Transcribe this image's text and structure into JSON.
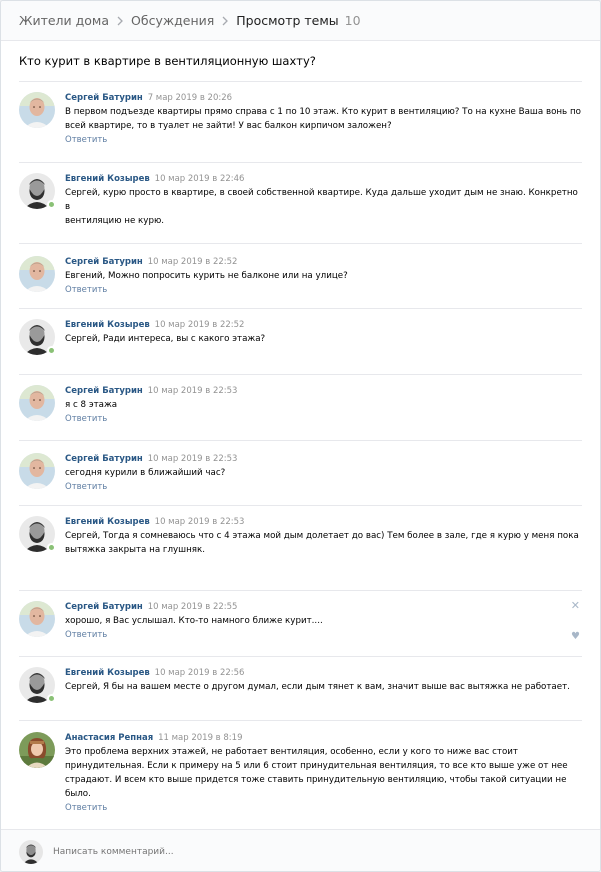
{
  "breadcrumbs": {
    "items": [
      "Жители дома",
      "Обсуждения"
    ],
    "current": "Просмотр темы",
    "count": "10"
  },
  "topic": {
    "title": "Кто курит в квартире в вентиляционную шахту?"
  },
  "comments": [
    {
      "author": "Сергей Батурин",
      "date": "7 мар 2019 в 20:26",
      "lines": [
        "В первом подъезде квартиры прямо справа с 1 по 10 этаж. Кто курит в вентиляцию? То на кухне Ваша вонь по",
        "всей квартире, то в туалет не зайти! У вас балкон кирпичом заложен?"
      ],
      "reply": "Ответить",
      "avatar": "sergey"
    },
    {
      "author": "Евгений Козырев",
      "date": "10 мар 2019 в 22:46",
      "lines": [
        "Сергей, курю просто в квартире, в своей собственной квартире. Куда дальше уходит дым не знаю. Конкретно в",
        "вентиляцию не курю."
      ],
      "reply": "",
      "avatar": "evgeny"
    },
    {
      "author": "Сергей Батурин",
      "date": "10 мар 2019 в 22:52",
      "lines": [
        "Евгений, Можно попросить курить не балконе или на улице?"
      ],
      "reply": "Ответить",
      "avatar": "sergey"
    },
    {
      "author": "Евгений Козырев",
      "date": "10 мар 2019 в 22:52",
      "lines": [
        "Сергей, Ради интереса, вы с какого этажа?"
      ],
      "reply": "",
      "avatar": "evgeny"
    },
    {
      "author": "Сергей Батурин",
      "date": "10 мар 2019 в 22:53",
      "lines": [
        "я с 8 этажа"
      ],
      "reply": "Ответить",
      "avatar": "sergey"
    },
    {
      "author": "Сергей Батурин",
      "date": "10 мар 2019 в 22:53",
      "lines": [
        "сегодня курили в ближайший час?"
      ],
      "reply": "Ответить",
      "avatar": "sergey"
    },
    {
      "author": "Евгений Козырев",
      "date": "10 мар 2019 в 22:53",
      "lines": [
        "Сергей, Тогда я сомневаюсь что с 4 этажа мой дым долетает до вас) Тем более в зале, где я курю у меня пока",
        "вытяжка закрыта на глушняк."
      ],
      "reply": "",
      "avatar": "evgeny"
    },
    {
      "author": "Сергей Батурин",
      "date": "10 мар 2019 в 22:55",
      "lines": [
        "хорошо, я Вас услышал. Кто-то намного ближе курит...."
      ],
      "reply": "Ответить",
      "avatar": "sergey"
    },
    {
      "author": "Евгений Козырев",
      "date": "10 мар 2019 в 22:56",
      "lines": [
        "Сергей, Я бы на вашем месте о другом думал, если дым тянет к вам, значит выше вас вытяжка не работает."
      ],
      "reply": "",
      "avatar": "evgeny"
    },
    {
      "author": "Анастасия Репная",
      "date": "11 мар 2019 в 8:19",
      "lines": [
        "Это проблема верхних этажей, не работает вентиляция, особенно, если у кого то ниже вас стоит",
        "принудительная. Если к примеру на 5 или 6 стоит принудительная вентиляция, то все кто выше уже от нее",
        "страдают. И всем кто выше придется тоже ставить принудительную вентиляцию, чтобы такой ситуации не",
        "было."
      ],
      "reply": "Ответить",
      "avatar": "anastasia"
    }
  ],
  "composer": {
    "placeholder": "Написать комментарий..."
  },
  "icons": {
    "close": "close-icon",
    "like": "heart-icon",
    "separator": "chevron-right-icon"
  }
}
